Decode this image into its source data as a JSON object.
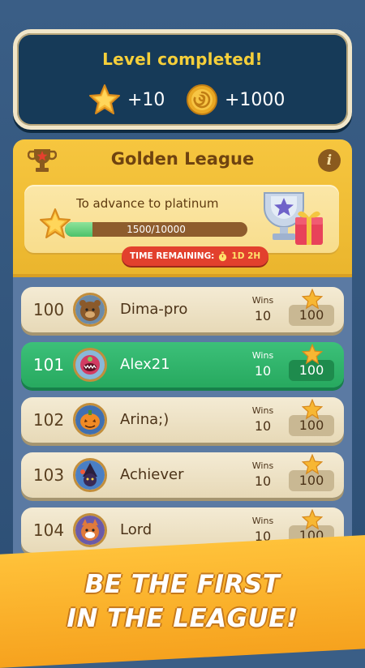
{
  "level": {
    "title": "Level completed!",
    "star_reward": "+10",
    "coin_reward": "+1000"
  },
  "league": {
    "title": "Golden League",
    "info_glyph": "i",
    "advance_text": "To advance to platinum",
    "progress_text": "1500/10000",
    "progress_fraction": 0.15,
    "time_label": "TIME REMAINING:",
    "time_value": "1D 2H"
  },
  "leaderboard": {
    "wins_label": "Wins",
    "rows": [
      {
        "rank": "100",
        "name": "Dima-pro",
        "wins": "10",
        "score": "100",
        "highlight": false,
        "avatar": "bear-icon"
      },
      {
        "rank": "101",
        "name": "Alex21",
        "wins": "10",
        "score": "100",
        "highlight": true,
        "avatar": "plant-monster-icon"
      },
      {
        "rank": "102",
        "name": "Arina;)",
        "wins": "10",
        "score": "100",
        "highlight": false,
        "avatar": "pumpkin-icon"
      },
      {
        "rank": "103",
        "name": "Achiever",
        "wins": "10",
        "score": "100",
        "highlight": false,
        "avatar": "witch-icon"
      },
      {
        "rank": "104",
        "name": "Lord",
        "wins": "10",
        "score": "100",
        "highlight": false,
        "avatar": "cat-icon"
      }
    ]
  },
  "banner": {
    "line1": "BE THE FIRST",
    "line2": "IN THE LEAGUE!"
  },
  "colors": {
    "gold": "#f5cf3a",
    "highlight_row": "#2fb46a",
    "time_badge": "#e2402d"
  }
}
